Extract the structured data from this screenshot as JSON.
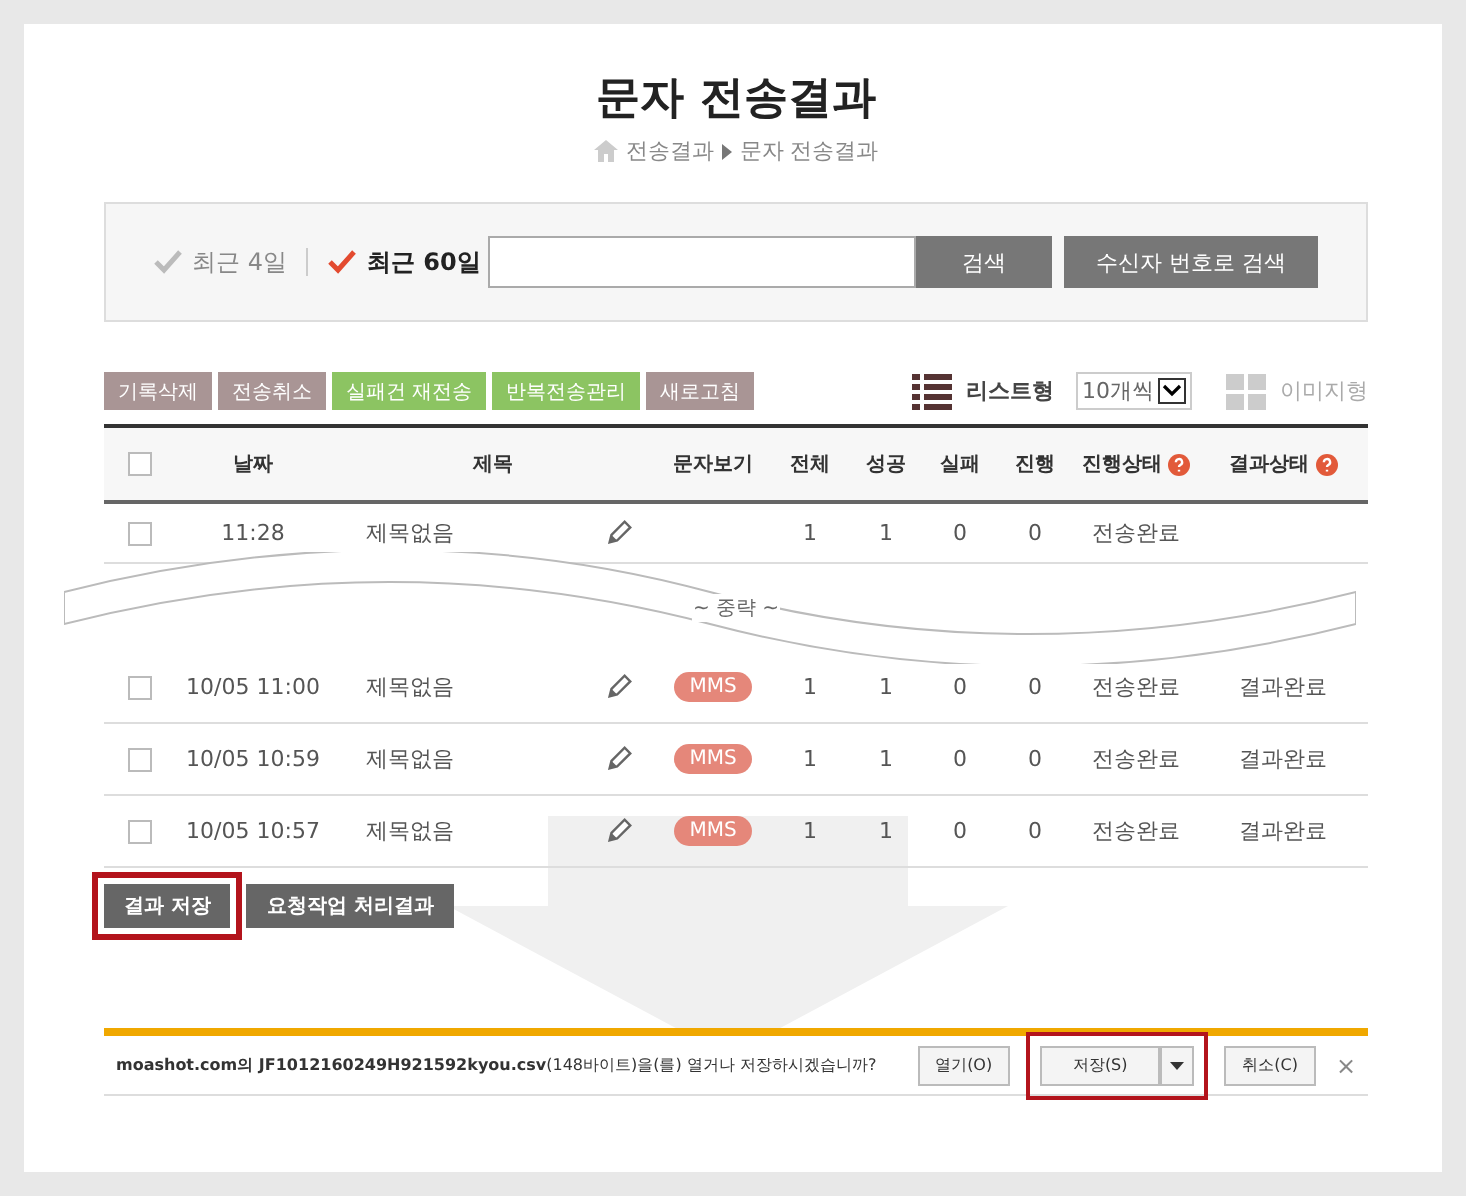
{
  "page": {
    "title": "문자 전송결과",
    "breadcrumb": [
      "전송결과",
      "문자 전송결과"
    ]
  },
  "filters": [
    {
      "label": "최근 4일",
      "selected": false
    },
    {
      "label": "최근 60일",
      "selected": true
    }
  ],
  "search": {
    "button": "검색",
    "recipient_button": "수신자 번호로 검색"
  },
  "actions": [
    {
      "label": "기록삭제",
      "kind": "mauve"
    },
    {
      "label": "전송취소",
      "kind": "mauve"
    },
    {
      "label": "실패건 재전송",
      "kind": "green"
    },
    {
      "label": "반복전송관리",
      "kind": "green"
    },
    {
      "label": "새로고침",
      "kind": "mauve"
    }
  ],
  "view": {
    "list_label": "리스트형",
    "per_page": "10개씩",
    "image_label": "이미지형",
    "list_selected": true
  },
  "table": {
    "columns": [
      "날짜",
      "제목",
      "문자보기",
      "전체",
      "성공",
      "실패",
      "진행",
      "진행상태",
      "결과상태"
    ],
    "all_checked": false,
    "rows": [
      {
        "checked": false,
        "date": "11:28",
        "subject": "제목없음",
        "total": "1",
        "success": "1",
        "fail": "0",
        "progress": "0",
        "send_status": "전송완료"
      },
      {
        "checked": false,
        "date": "10/05 11:00",
        "subject": "제목없음",
        "badge": "MMS",
        "total": "1",
        "success": "1",
        "fail": "0",
        "progress": "0",
        "send_status": "전송완료",
        "result_status": "결과완료"
      },
      {
        "checked": false,
        "date": "10/05 10:59",
        "subject": "제목없음",
        "badge": "MMS",
        "total": "1",
        "success": "1",
        "fail": "0",
        "progress": "0",
        "send_status": "전송완료",
        "result_status": "결과완료"
      },
      {
        "checked": false,
        "date": "10/05 10:57",
        "subject": "제목없음",
        "badge": "MMS",
        "total": "1",
        "success": "1",
        "fail": "0",
        "progress": "0",
        "send_status": "전송완료",
        "result_status": "결과완료"
      }
    ]
  },
  "omission": "~ 중략 ~",
  "bottom_buttons": [
    {
      "label": "결과 저장",
      "highlighted": true
    },
    {
      "label": "요청작업 처리결과",
      "highlighted": false
    }
  ],
  "download_bar": {
    "site": "moashot.com의",
    "file": "JF1012160249H921592kyou.csv",
    "message": "(148바이트)을(를) 열거나 저장하시겠습니까?",
    "open": "열기(O)",
    "save": "저장(S)",
    "save_highlighted": true,
    "cancel": "취소(C)",
    "close": "×"
  }
}
